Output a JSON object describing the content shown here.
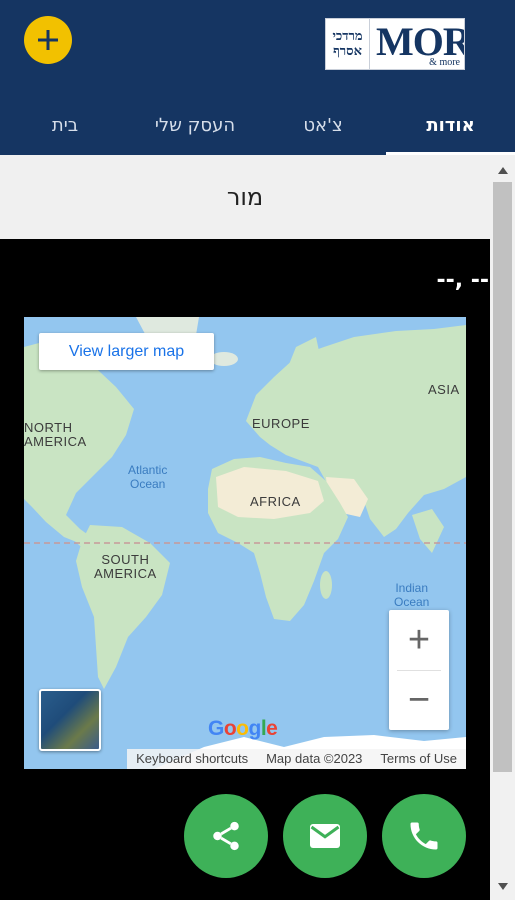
{
  "header": {
    "add_icon": "plus-icon",
    "logo": {
      "hebrew_line1": "מרדכי",
      "hebrew_line2": "אסרף",
      "brand": "MOR",
      "brand_suffix": "& more"
    }
  },
  "tabs": [
    {
      "label": "אודות",
      "active": true
    },
    {
      "label": "צ'אט",
      "active": false
    },
    {
      "label": "העסק שלי",
      "active": false
    },
    {
      "label": "בית",
      "active": false
    }
  ],
  "page": {
    "title": "מור",
    "date_text": "-- ,--"
  },
  "map": {
    "larger_map_label": "View larger map",
    "labels": {
      "north_america": "NORTH\nAMERICA",
      "europe": "EUROPE",
      "asia": "ASIA",
      "africa": "AFRICA",
      "south_america": "SOUTH\nAMERICA",
      "atlantic": "Atlantic\nOcean",
      "indian": "Indian\nOcean"
    },
    "zoom_in": "+",
    "zoom_out": "−",
    "google_logo": "Google",
    "attribution": {
      "shortcuts": "Keyboard shortcuts",
      "data": "Map data ©2023",
      "terms": "Terms of Use"
    },
    "colors": {
      "water": "#93c6ef",
      "land": "#c9e4c3",
      "desert": "#f3ecd6"
    }
  },
  "actions": {
    "share_icon": "share-icon",
    "email_icon": "email-icon",
    "phone_icon": "phone-icon",
    "color": "#3eb158"
  },
  "colors": {
    "header": "#153562",
    "accent": "#f2c100"
  }
}
